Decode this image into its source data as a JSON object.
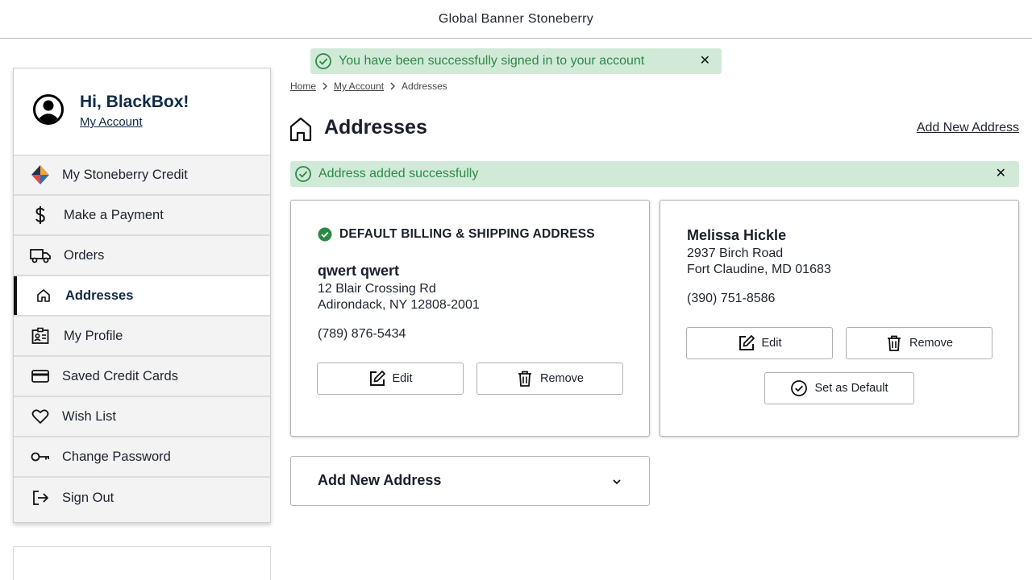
{
  "banner": {
    "text": "Global Banner Stoneberry"
  },
  "sidebar": {
    "greeting": "Hi, BlackBox!",
    "account_link": "My Account",
    "items": [
      {
        "label": "My Stoneberry Credit",
        "icon": "stoneberry-credit-icon"
      },
      {
        "label": "Make a Payment",
        "icon": "dollar-icon"
      },
      {
        "label": "Orders",
        "icon": "truck-icon"
      },
      {
        "label": "Addresses",
        "icon": "home-icon",
        "active": true
      },
      {
        "label": "My Profile",
        "icon": "id-badge-icon"
      },
      {
        "label": "Saved Credit Cards",
        "icon": "credit-card-icon"
      },
      {
        "label": "Wish List",
        "icon": "heart-icon"
      },
      {
        "label": "Change Password",
        "icon": "key-icon"
      },
      {
        "label": "Sign Out",
        "icon": "sign-out-icon"
      }
    ]
  },
  "toast": {
    "message": "You have been successfully signed in to your account",
    "close": "✕"
  },
  "breadcrumb": {
    "items": [
      "Home",
      "My Account",
      "Addresses"
    ]
  },
  "page": {
    "title": "Addresses",
    "add_link": "Add New Address",
    "success_message": "Address added successfully",
    "success_close": "✕"
  },
  "addresses": [
    {
      "default_label": "DEFAULT BILLING & SHIPPING ADDRESS",
      "name": "qwert qwert",
      "line1": "12 Blair Crossing Rd",
      "line2": "Adirondack, NY 12808-2001",
      "phone": "(789) 876-5434",
      "edit_label": "Edit",
      "remove_label": "Remove"
    },
    {
      "name": "Melissa Hickle",
      "line1": "2937 Birch Road",
      "line2": "Fort Claudine, MD 01683",
      "phone": "(390) 751-8586",
      "edit_label": "Edit",
      "remove_label": "Remove",
      "set_default_label": "Set as Default"
    }
  ],
  "add_new_section": {
    "label": "Add New Address"
  },
  "colors": {
    "success_bg": "#d1ead8",
    "success_text": "#2c8a45",
    "navy": "#0e2a47"
  }
}
